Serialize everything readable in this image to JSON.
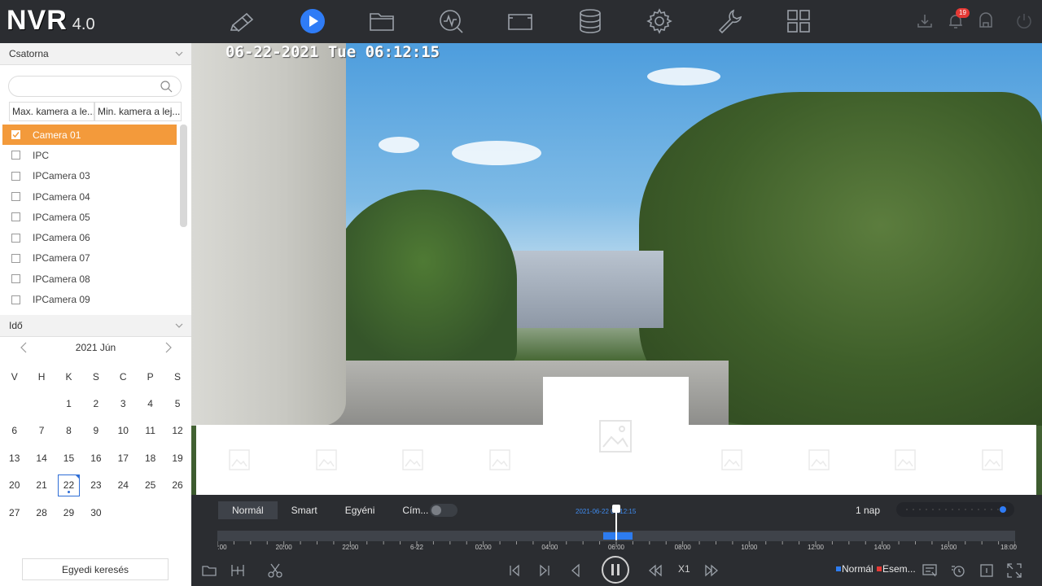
{
  "header": {
    "brand": "NVR",
    "version": "4.0",
    "nav_icons": [
      "live-view-icon",
      "playback-icon",
      "file-icon",
      "smart-analysis-icon",
      "camera-icon",
      "storage-icon",
      "settings-icon",
      "maintenance-icon",
      "layout-icon"
    ],
    "notification_count": "19",
    "accent": "#2f7cf6"
  },
  "sidebar": {
    "channel_section": "Csatorna",
    "search_placeholder": "",
    "sort_max": "Max. kamera a le...",
    "sort_min": "Min. kamera a lej...",
    "cameras": [
      {
        "label": "Camera 01",
        "checked": true
      },
      {
        "label": "IPC",
        "checked": false
      },
      {
        "label": "IPCamera 03",
        "checked": false
      },
      {
        "label": "IPCamera 04",
        "checked": false
      },
      {
        "label": "IPCamera 05",
        "checked": false
      },
      {
        "label": "IPCamera 06",
        "checked": false
      },
      {
        "label": "IPCamera 07",
        "checked": false
      },
      {
        "label": "IPCamera 08",
        "checked": false
      },
      {
        "label": "IPCamera 09",
        "checked": false
      }
    ],
    "time_section": "Idő",
    "calendar": {
      "month_label": "2021 Jún",
      "weekdays": [
        "V",
        "H",
        "K",
        "S",
        "C",
        "P",
        "S"
      ],
      "leading_blanks": 2,
      "days": [
        "1",
        "2",
        "3",
        "4",
        "5",
        "6",
        "7",
        "8",
        "9",
        "10",
        "11",
        "12",
        "13",
        "14",
        "15",
        "16",
        "17",
        "18",
        "19",
        "20",
        "21",
        "22",
        "23",
        "24",
        "25",
        "26",
        "27",
        "28",
        "29",
        "30"
      ],
      "selected_day": "22"
    },
    "custom_search": "Egyedi keresés",
    "selected_color": "#f39a3b"
  },
  "video": {
    "osd_timestamp": "06-22-2021 Tue 06:12:15"
  },
  "playback": {
    "modes": [
      {
        "label": "Normál",
        "active": true
      },
      {
        "label": "Smart",
        "active": false
      },
      {
        "label": "Egyéni",
        "active": false
      },
      {
        "label": "Cím...",
        "active": false
      }
    ],
    "timeline_time": "2021-06-22 06:12:15",
    "range": "1 nap",
    "tick_labels": [
      ":00",
      "20:00",
      "22:00",
      "6-22",
      "02:00",
      "04:00",
      "06:00",
      "08:00",
      "10:00",
      "12:00",
      "14:00",
      "16:00",
      "18:00"
    ],
    "speed": "X1",
    "legend_normal": "Normál",
    "legend_event": "Esem...",
    "legend_normal_color": "#2d7cf0",
    "legend_event_color": "#e53935"
  }
}
